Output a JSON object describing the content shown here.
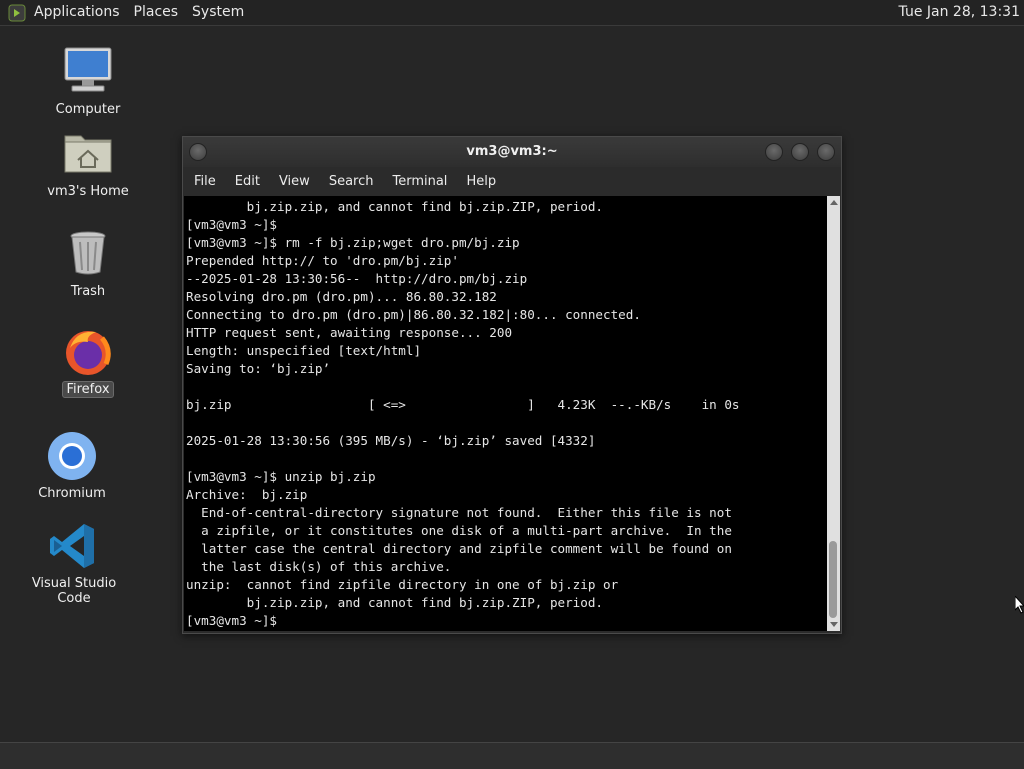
{
  "top_panel": {
    "menus": [
      "Applications",
      "Places",
      "System"
    ],
    "clock": "Tue Jan 28, 13:31"
  },
  "desktop": {
    "icons": [
      {
        "label": "Computer",
        "icon": "computer-icon"
      },
      {
        "label": "vm3's Home",
        "icon": "home-folder-icon"
      },
      {
        "label": "Trash",
        "icon": "trash-icon"
      },
      {
        "label": "Firefox",
        "icon": "firefox-icon",
        "selected": true
      },
      {
        "label": "Chromium",
        "icon": "chromium-icon"
      },
      {
        "label": "Visual Studio Code",
        "icon": "vscode-icon"
      }
    ]
  },
  "terminal": {
    "title": "vm3@vm3:~",
    "menu": [
      "File",
      "Edit",
      "View",
      "Search",
      "Terminal",
      "Help"
    ],
    "lines": [
      "        bj.zip.zip, and cannot find bj.zip.ZIP, period.",
      "[vm3@vm3 ~]$",
      "[vm3@vm3 ~]$ rm -f bj.zip;wget dro.pm/bj.zip",
      "Prepended http:// to 'dro.pm/bj.zip'",
      "--2025-01-28 13:30:56--  http://dro.pm/bj.zip",
      "Resolving dro.pm (dro.pm)... 86.80.32.182",
      "Connecting to dro.pm (dro.pm)|86.80.32.182|:80... connected.",
      "HTTP request sent, awaiting response... 200",
      "Length: unspecified [text/html]",
      "Saving to: ‘bj.zip’",
      "",
      "bj.zip                  [ <=>                ]   4.23K  --.-KB/s    in 0s",
      "",
      "2025-01-28 13:30:56 (395 MB/s) - ‘bj.zip’ saved [4332]",
      "",
      "[vm3@vm3 ~]$ unzip bj.zip",
      "Archive:  bj.zip",
      "  End-of-central-directory signature not found.  Either this file is not",
      "  a zipfile, or it constitutes one disk of a multi-part archive.  In the",
      "  latter case the central directory and zipfile comment will be found on",
      "  the last disk(s) of this archive.",
      "unzip:  cannot find zipfile directory in one of bj.zip or",
      "        bj.zip.zip, and cannot find bj.zip.ZIP, period.",
      "[vm3@vm3 ~]$ "
    ]
  }
}
